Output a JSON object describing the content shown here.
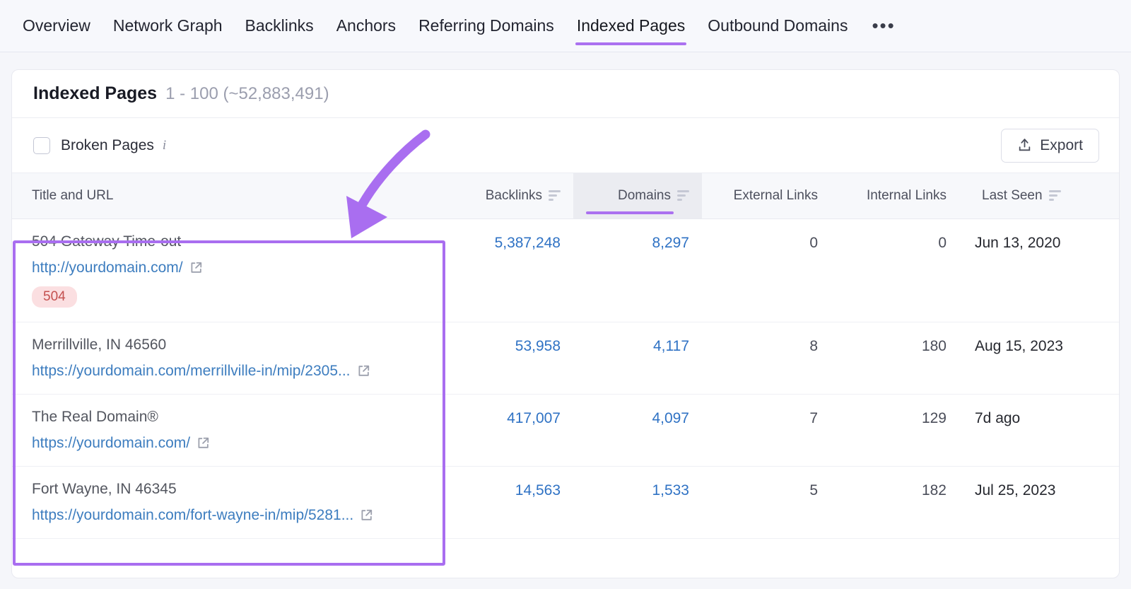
{
  "tabs": [
    {
      "label": "Overview",
      "active": false
    },
    {
      "label": "Network Graph",
      "active": false
    },
    {
      "label": "Backlinks",
      "active": false
    },
    {
      "label": "Anchors",
      "active": false
    },
    {
      "label": "Referring Domains",
      "active": false
    },
    {
      "label": "Indexed Pages",
      "active": true
    },
    {
      "label": "Outbound Domains",
      "active": false
    }
  ],
  "tabs_more_label": "•••",
  "card": {
    "title": "Indexed Pages",
    "count": "1 - 100 (~52,883,491)"
  },
  "filters": {
    "broken_pages_label": "Broken Pages",
    "broken_pages_checked": false,
    "info_icon": "info-icon",
    "export_label": "Export",
    "export_icon": "upload-icon"
  },
  "table": {
    "columns": [
      {
        "label": "Title and URL",
        "sortable": false,
        "active": false,
        "align": "left"
      },
      {
        "label": "Backlinks",
        "sortable": true,
        "active": false,
        "align": "right"
      },
      {
        "label": "Domains",
        "sortable": true,
        "active": true,
        "align": "right"
      },
      {
        "label": "External Links",
        "sortable": false,
        "active": false,
        "align": "right"
      },
      {
        "label": "Internal Links",
        "sortable": false,
        "active": false,
        "align": "right"
      },
      {
        "label": "Last Seen",
        "sortable": true,
        "active": false,
        "align": "left"
      }
    ],
    "rows": [
      {
        "title": "504 Gateway Time-out",
        "url": "http://yourdomain.com/",
        "status_badge": "504",
        "backlinks": "5,387,248",
        "domains": "8,297",
        "external_links": "0",
        "internal_links": "0",
        "last_seen": "Jun 13, 2020"
      },
      {
        "title": "Merrillville, IN 46560",
        "url": "https://yourdomain.com/merrillville-in/mip/2305...",
        "status_badge": null,
        "backlinks": "53,958",
        "domains": "4,117",
        "external_links": "8",
        "internal_links": "180",
        "last_seen": "Aug 15, 2023"
      },
      {
        "title": "The Real Domain®",
        "url": "https://yourdomain.com/",
        "status_badge": null,
        "backlinks": "417,007",
        "domains": "4,097",
        "external_links": "7",
        "internal_links": "129",
        "last_seen": "7d ago"
      },
      {
        "title": "Fort Wayne, IN 46345",
        "url": "https://yourdomain.com/fort-wayne-in/mip/5281...",
        "status_badge": null,
        "backlinks": "14,563",
        "domains": "1,533",
        "external_links": "5",
        "internal_links": "182",
        "last_seen": "Jul 25, 2023"
      }
    ]
  },
  "annotations": {
    "arrow": "curved-arrow-annotation",
    "highlight_box": "title-url-column-highlight"
  },
  "colors": {
    "accent_purple": "#ab71f0",
    "annotation_purple": "#a96ef0",
    "link_blue": "#3d7dbf",
    "badge_bg": "#fbdfe1",
    "badge_text": "#c4504f"
  }
}
